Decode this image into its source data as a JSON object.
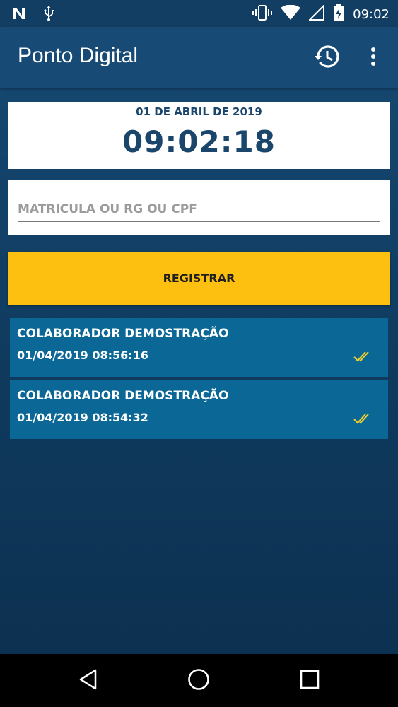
{
  "status_bar": {
    "time": "09:02",
    "icons": [
      "n-notification-icon",
      "usb-icon",
      "vibrate-icon",
      "wifi-icon",
      "signal-icon",
      "battery-charging-icon"
    ]
  },
  "app_bar": {
    "title": "Ponto Digital",
    "history_icon": "history-icon",
    "more_icon": "more-vert-icon"
  },
  "clock": {
    "date": "01 DE ABRIL DE 2019",
    "time": "09:02:18"
  },
  "id_input": {
    "placeholder": "MATRICULA OU RG OU CPF",
    "value": ""
  },
  "register_button": {
    "label": "REGISTRAR"
  },
  "records": [
    {
      "name": "COLABORADOR DEMOSTRAÇÃO",
      "timestamp": "01/04/2019 08:56:16",
      "status_icon": "double-check-icon"
    },
    {
      "name": "COLABORADOR DEMOSTRAÇÃO",
      "timestamp": "01/04/2019 08:54:32",
      "status_icon": "double-check-icon"
    }
  ],
  "colors": {
    "primary": "#174a74",
    "accent": "#fdc010",
    "record_bg": "#0a6796",
    "clock_text": "#1b466b",
    "check": "#f2d22c"
  },
  "nav_bar": {
    "icons": [
      "back-icon",
      "home-icon",
      "recents-icon"
    ]
  }
}
